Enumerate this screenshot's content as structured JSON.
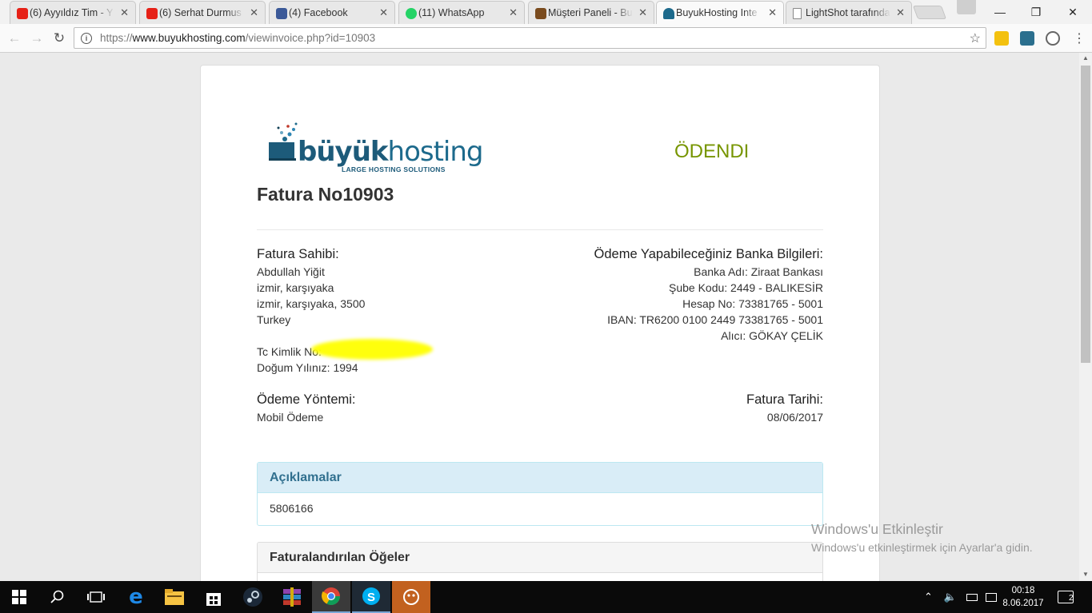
{
  "browser": {
    "tabs": [
      {
        "label": "(6) Ayyıldız Tim - Y",
        "icon": "youtube-icon",
        "color": "#e62117"
      },
      {
        "label": "(6) Serhat Durmus",
        "icon": "youtube-icon",
        "color": "#e62117"
      },
      {
        "label": "(4) Facebook",
        "icon": "facebook-icon",
        "color": "#3b5998"
      },
      {
        "label": "(11) WhatsApp",
        "icon": "whatsapp-icon",
        "color": "#25d366"
      },
      {
        "label": "Müşteri Paneli - Bu",
        "icon": "panel-icon",
        "color": "#7a4b1e"
      },
      {
        "label": "BuyukHosting Inte",
        "icon": "hosting-icon",
        "color": "#1d6a8c"
      },
      {
        "label": "LightShot tarafında",
        "icon": "page-icon",
        "color": "#888888"
      }
    ],
    "url_scheme": "https://",
    "url_host": "www.buyukhosting.com",
    "url_path": "/viewinvoice.php?id=10903"
  },
  "invoice": {
    "logo_bold": "büyük",
    "logo_light": "hosting",
    "logo_tagline": "LARGE HOSTING SOLUTIONS",
    "status": "ÖDENDI",
    "title": "Fatura No10903",
    "billed_to": {
      "heading": "Fatura Sahibi:",
      "name": "Abdullah Yiğit",
      "address1": "izmir, karşıyaka",
      "address2": "izmir, karşıyaka, 3500",
      "country": "Turkey",
      "tc_label": "Tc Kimlik No:",
      "birth_year": "Doğum Yılınız: 1994"
    },
    "bank": {
      "heading": "Ödeme Yapabileceğiniz Banka Bilgileri:",
      "bank_name": "Banka Adı: Ziraat Bankası",
      "branch": "Şube Kodu: 2449 - BALIKESİR",
      "account": "Hesap No: 73381765 - 5001",
      "iban": "IBAN: TR6200 0100 2449 73381765 - 5001",
      "recipient": "Alıcı: GÖKAY ÇELİK"
    },
    "payment_method": {
      "heading": "Ödeme Yöntemi:",
      "value": "Mobil Ödeme"
    },
    "invoice_date": {
      "heading": "Fatura Tarihi:",
      "value": "08/06/2017"
    },
    "notes_panel": {
      "heading": "Açıklamalar",
      "value": "5806166"
    },
    "items_panel": {
      "heading": "Faturalandırılan Öğeler"
    }
  },
  "watermark": {
    "line1": "Windows'u Etkinleştir",
    "line2": "Windows'u etkinleştirmek için Ayarlar'a gidin."
  },
  "taskbar": {
    "time": "00:18",
    "date": "8.06.2017",
    "notification_count": "2"
  },
  "colors": {
    "paid_status": "#779500",
    "info_panel_header": "#d9edf7",
    "highlight": "#ffff00"
  }
}
